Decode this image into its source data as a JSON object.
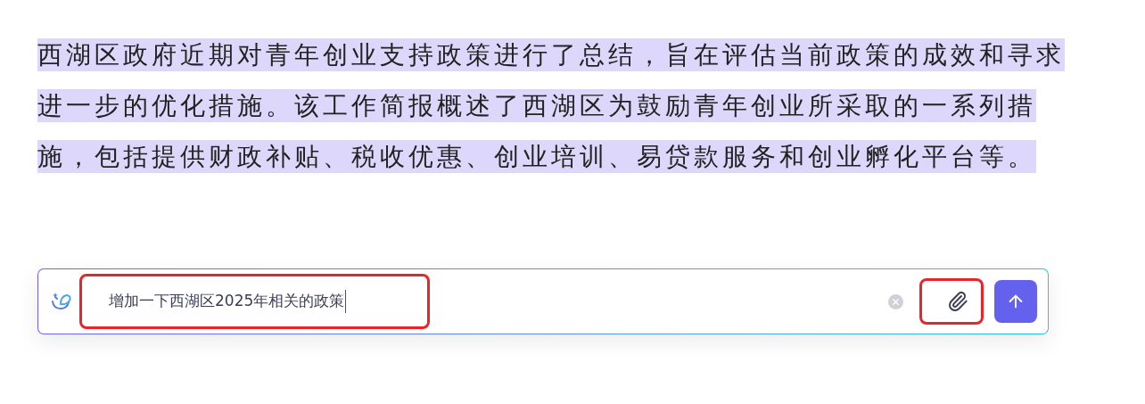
{
  "paragraph": {
    "text": "西湖区政府近期对青年创业支持政策进行了总结，旨在评估当前政策的成效和寻求进一步的优化措施。该工作简报概述了西湖区为鼓励青年创业所采取的一系列措施，包括提供财政补贴、税收优惠、创业培训、易贷款服务和创业孵化平台等。",
    "selected": true
  },
  "prompt_box": {
    "value": "增加一下西湖区2025年相关的政策",
    "highlighted": true,
    "attach_button": {
      "highlighted": true
    }
  }
}
